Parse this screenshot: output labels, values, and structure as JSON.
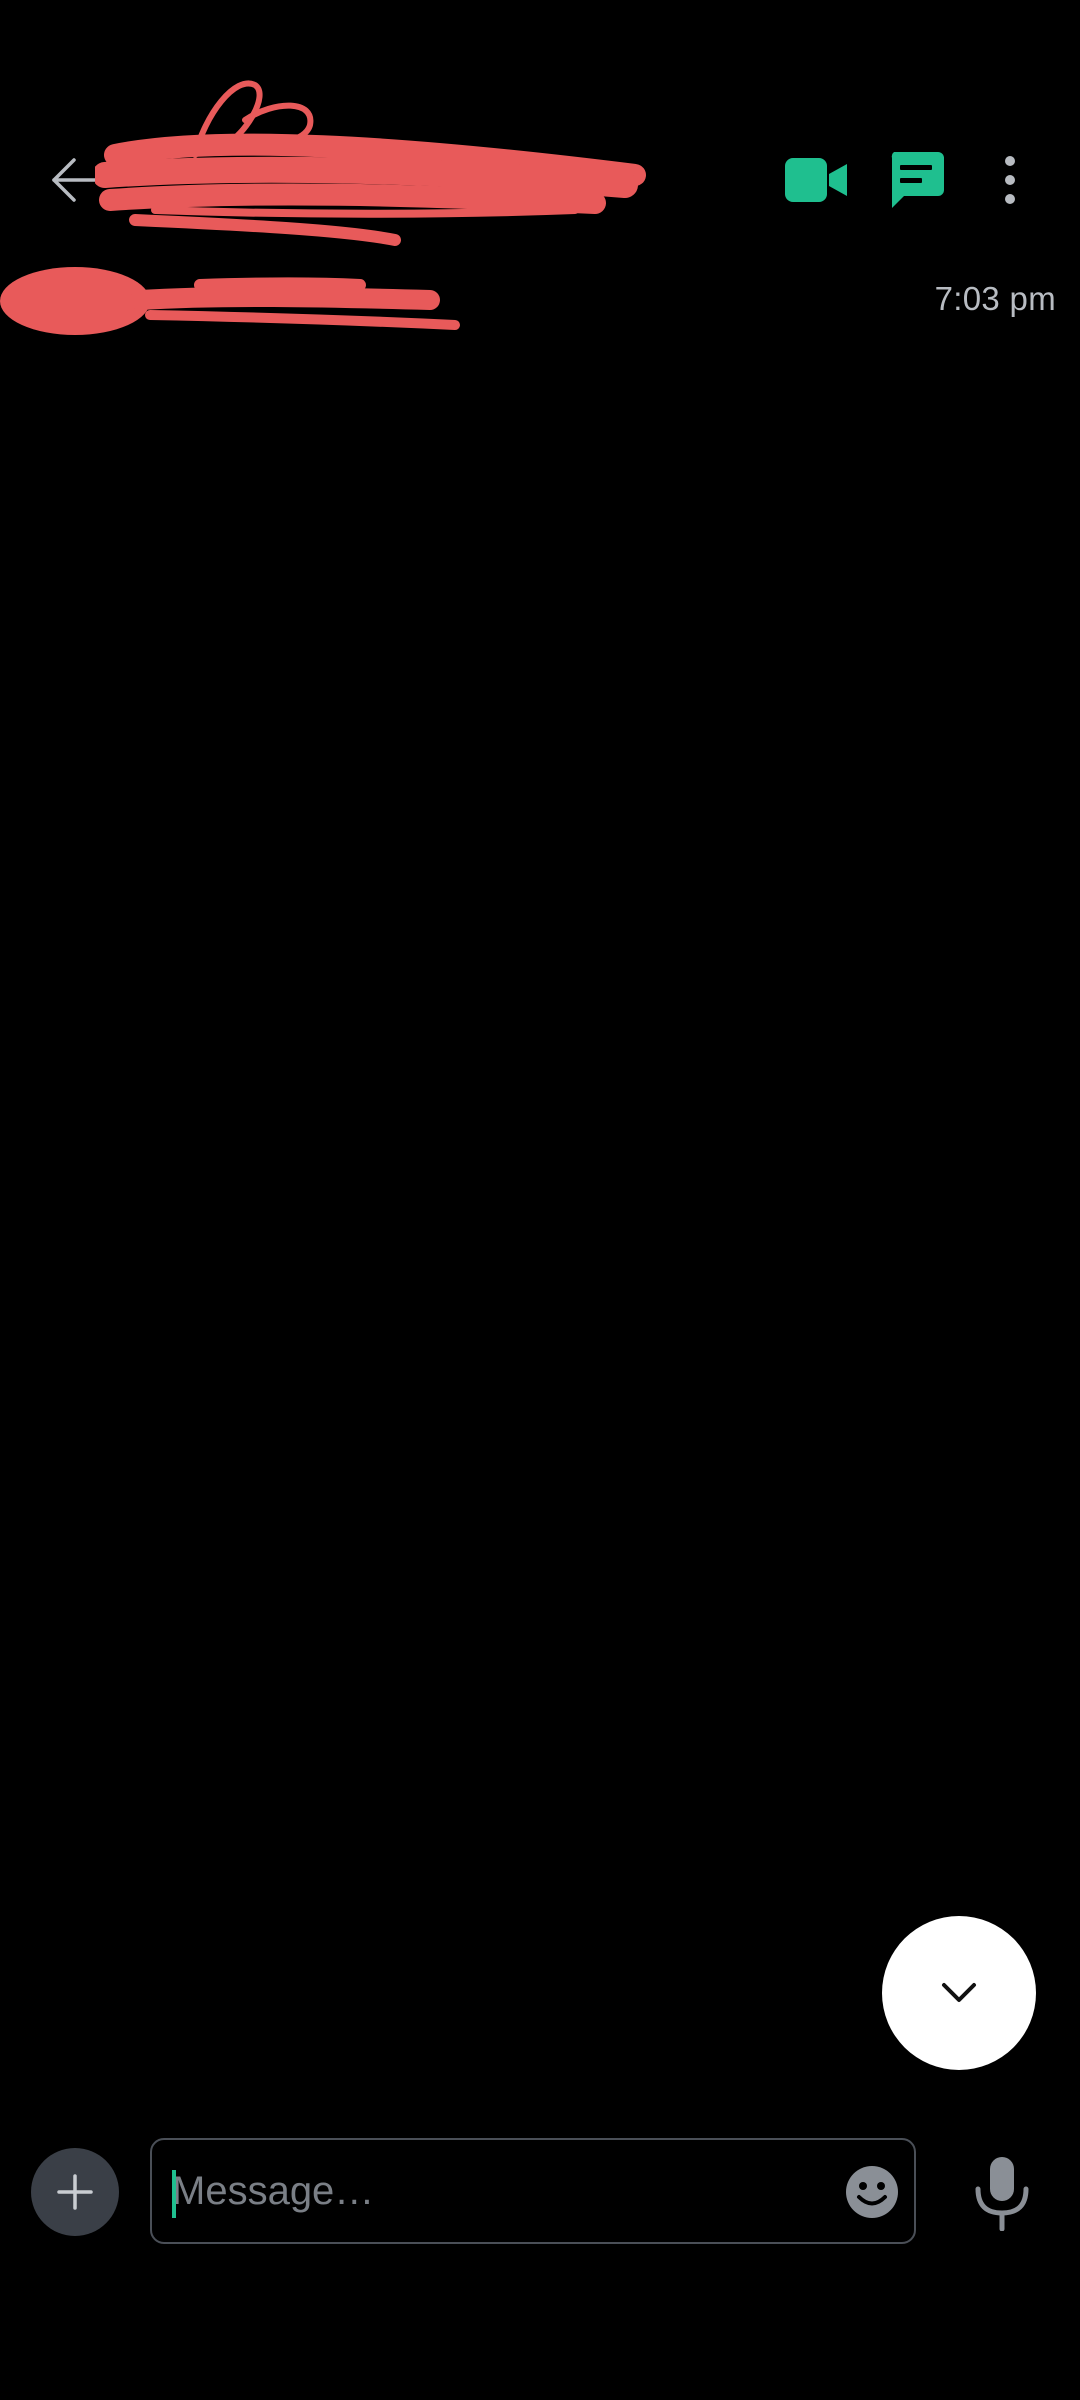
{
  "header": {
    "back_icon": "arrow-left-icon",
    "video_call_icon": "video-camera-icon",
    "chat_icon": "chat-bubble-icon",
    "more_icon": "more-vertical-icon",
    "redaction_note": ""
  },
  "conversation": {
    "timestamp": "7:03 pm"
  },
  "scroll_fab": {
    "icon": "chevron-down-icon"
  },
  "composer": {
    "add_icon": "plus-icon",
    "placeholder": "Message…",
    "value": "",
    "emoji_icon": "smiley-icon",
    "mic_icon": "microphone-icon"
  },
  "colors": {
    "background": "#000000",
    "accent_green": "#1fbf8f",
    "icon_gray": "#b8bcc2",
    "redaction_red": "#e85a5a",
    "fab_background": "#ffffff"
  }
}
